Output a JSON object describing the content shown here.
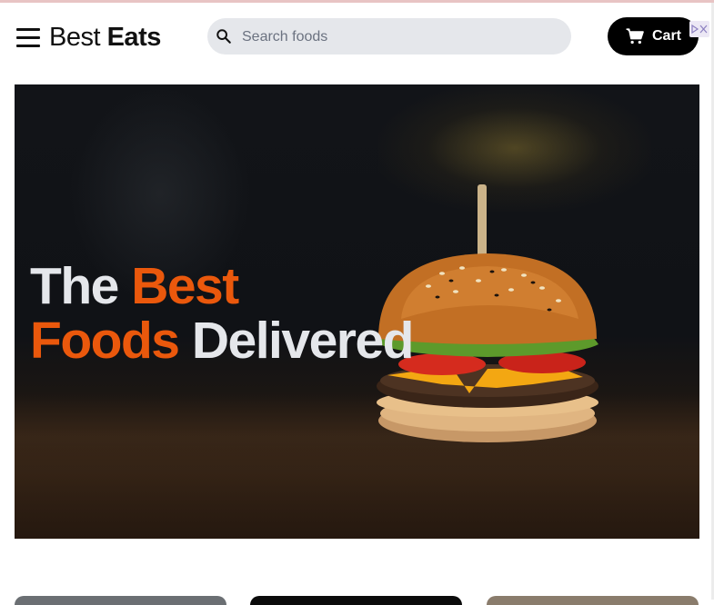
{
  "header": {
    "logo_part1": "Best",
    "logo_part2": "Eats",
    "search_placeholder": "Search foods",
    "cart_label": "Cart"
  },
  "hero": {
    "word_the": "The",
    "word_best": "Best",
    "word_foods": "Foods",
    "word_delivered": "Delivered",
    "accent_color": "#ea580c"
  },
  "icons": {
    "menu": "hamburger-menu-icon",
    "search": "search-icon",
    "cart": "shopping-cart-icon"
  }
}
